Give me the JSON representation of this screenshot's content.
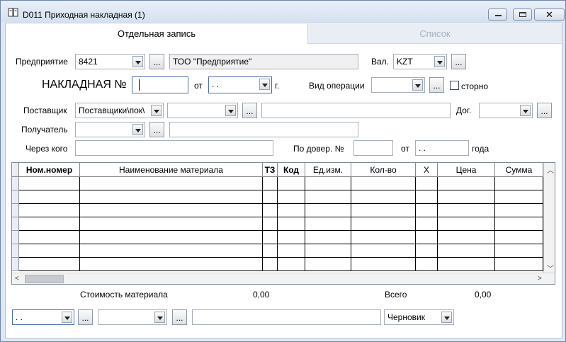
{
  "window": {
    "title": "D011 Приходная накладная (1)"
  },
  "tabs": [
    {
      "label": "Отдельная запись",
      "active": true
    },
    {
      "label": "Список",
      "active": false
    }
  ],
  "form": {
    "enterprise_label": "Предприятие",
    "enterprise_code": "8421",
    "enterprise_name": "ТОО \"Предприятие\"",
    "currency_label": "Вал.",
    "currency_value": "KZT",
    "invoice_label": "НАКЛАДНАЯ №",
    "invoice_number": "",
    "date_from_label": "от",
    "invoice_date": " .  .",
    "year_suffix": "г.",
    "operation_label": "Вид операции",
    "operation_value": "",
    "storno_label": "сторно",
    "supplier_label": "Поставщик",
    "supplier_type": "Поставщики\\пок\\",
    "supplier_code": "",
    "supplier_name": "",
    "contract_label": "Дог.",
    "contract_value": "",
    "receiver_label": "Получатель",
    "receiver_code": "",
    "receiver_name": "",
    "through_label": "Через кого",
    "through_value": "",
    "power_label": "По довер. №",
    "power_number": "",
    "power_from_label": "от",
    "power_date": " .  .",
    "power_year_label": "года"
  },
  "table": {
    "columns": [
      "Ном.номер",
      "Наименование материала",
      "ТЗ",
      "Код",
      "Ед.изм.",
      "Кол-во",
      "Х",
      "Цена",
      "Сумма"
    ],
    "rows": 7
  },
  "totals": {
    "material_cost_label": "Стоимость материала",
    "material_cost_value": "0,00",
    "total_label": "Всего",
    "total_value": "0,00"
  },
  "footer": {
    "date_value": " .  .",
    "select2_value": "",
    "comment_value": "",
    "status_value": "Черновик"
  },
  "colors": {
    "window_bg": "#dfe8f3",
    "border": "#6f86a6"
  }
}
